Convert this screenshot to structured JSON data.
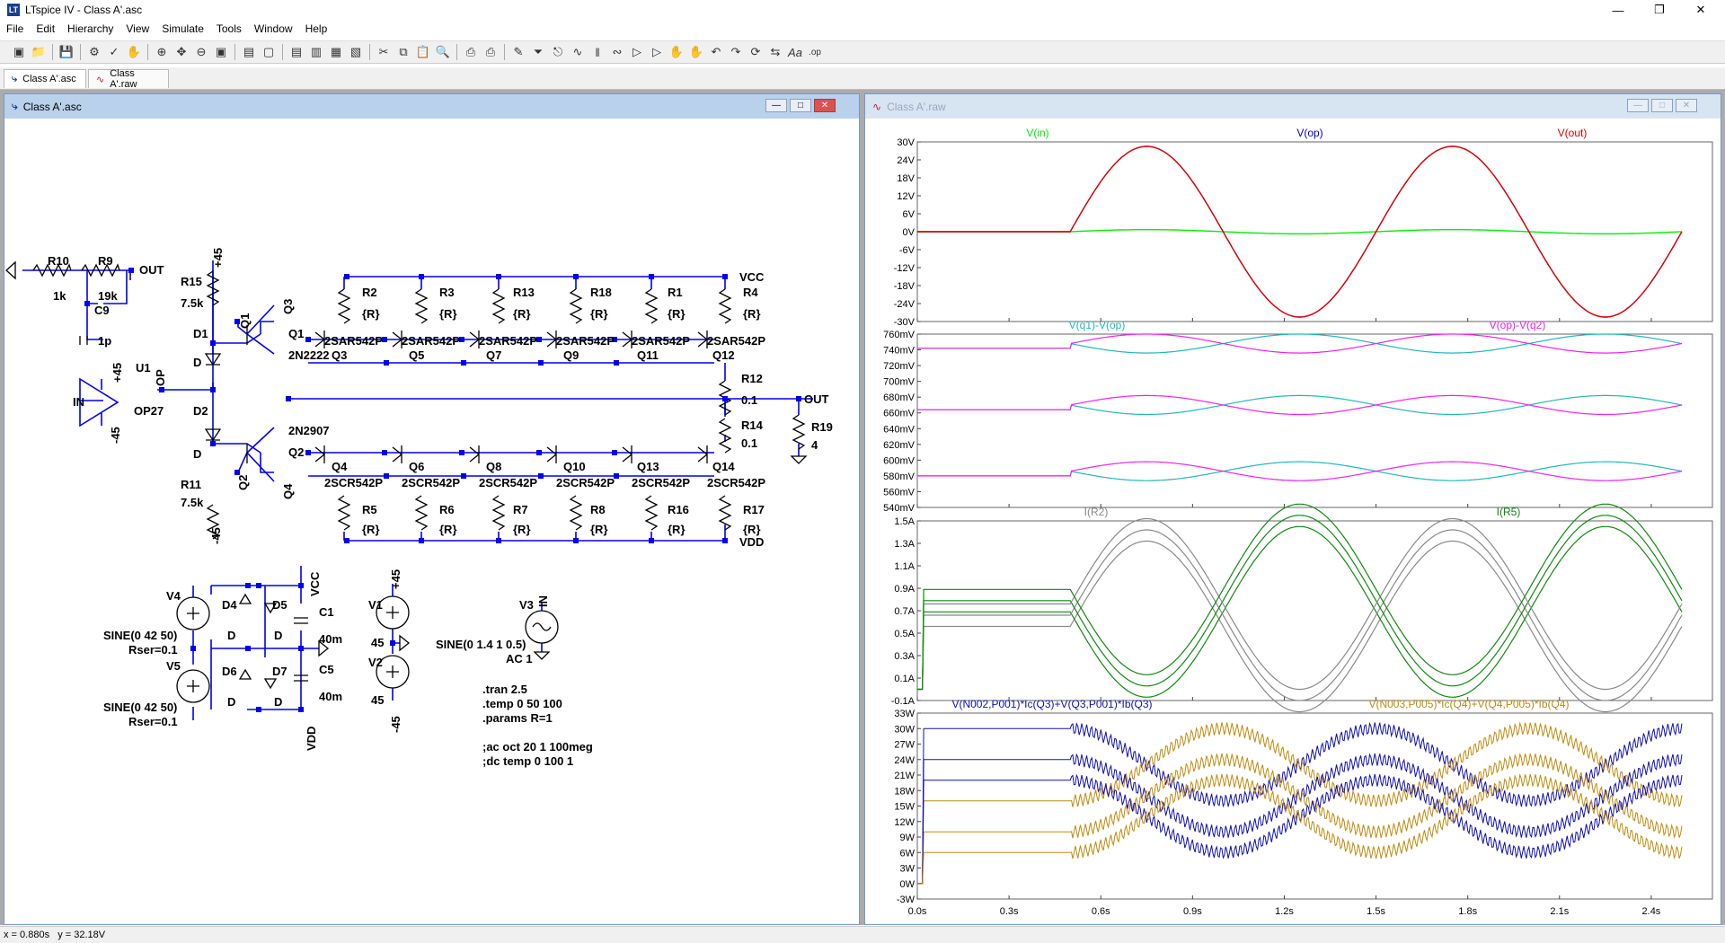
{
  "app": {
    "title": "LTspice IV - Class A'.asc",
    "icon": "ltspice-logo-icon"
  },
  "menu": [
    "File",
    "Edit",
    "Hierarchy",
    "View",
    "Simulate",
    "Tools",
    "Window",
    "Help"
  ],
  "tabs": [
    {
      "label": "Class A'.asc",
      "icon": "schematic-icon"
    },
    {
      "label": "Class A'.raw",
      "icon": "waveform-icon"
    }
  ],
  "schematic_window": {
    "title": "Class A'.asc"
  },
  "waveform_window": {
    "title": "Class A'.raw"
  },
  "schematic": {
    "labels": {
      "r10": "R10",
      "r9": "R9",
      "out_left": "OUT",
      "k1": "1k",
      "k19": "19k",
      "c9": "C9",
      "p1": "1p",
      "r15": "R15",
      "p45_top": "+45",
      "k75a": "7.5k",
      "q1v": "Q1",
      "q3v": "Q3",
      "d1": "D1",
      "d1v": "D",
      "q1": "Q1",
      "n2222": "2N2222",
      "u1": "U1",
      "p45_u1": "+45",
      "op": "OP",
      "in": "IN",
      "m45_u1": "-45",
      "op27": "OP27",
      "d2": "D2",
      "d2v": "D",
      "n2907": "2N2907",
      "q2": "Q2",
      "r11": "R11",
      "k75b": "7.5k",
      "m45_bot": "-45",
      "q2v": "Q2",
      "q4v": "Q4",
      "vcc": "VCC",
      "vdd": "VDD",
      "out_right": "OUT",
      "r12": "R12",
      "v01a": "0.1",
      "r14": "R14",
      "v01b": "0.1",
      "r19": "R19",
      "four": "4",
      "top_res": [
        "R2",
        "R3",
        "R13",
        "R18",
        "R1",
        "R4"
      ],
      "r_val": "{R}",
      "top_npn": [
        "Q3",
        "Q5",
        "Q7",
        "Q9",
        "Q11",
        "Q12"
      ],
      "top_part": "2SAR542P",
      "bot_pnp": [
        "Q4",
        "Q6",
        "Q8",
        "Q10",
        "Q13",
        "Q14"
      ],
      "bot_part": "2SCR542P",
      "bot_res": [
        "R5",
        "R6",
        "R7",
        "R8",
        "R16",
        "R17"
      ],
      "v4": "V4",
      "d4": "D4",
      "d5": "D5",
      "vcc2": "VCC",
      "c1": "C1",
      "m40a": "40m",
      "c5": "C5",
      "m40b": "40m",
      "vdd2": "VDD",
      "d4v": "D",
      "d5v": "D",
      "d6": "D6",
      "d7": "D7",
      "d6v": "D",
      "d7v": "D",
      "v5": "V5",
      "sine1": "SINE(0 42 50)",
      "rser1": "Rser=0.1",
      "sine2": "SINE(0 42 50)",
      "rser2": "Rser=0.1",
      "v1": "V1",
      "v1p": "+45",
      "v1v": "45",
      "v2": "V2",
      "v2v": "45",
      "v2m": "-45",
      "v3": "V3",
      "v3in": "IN",
      "sine3": "SINE(0 1.4 1 0.5)",
      "ac": "AC 1",
      "tran": ".tran 2.5",
      "temp": ".temp 0 50 100",
      "params": ".params R=1",
      "acoct": ";ac oct 20 1 100meg",
      "dctemp": ";dc temp 0 100 1"
    }
  },
  "waveform": {
    "pane1": {
      "traces": [
        "V(in)",
        "V(op)",
        "V(out)"
      ],
      "colors": [
        "#00ee00",
        "#0000cc",
        "#dd0000"
      ],
      "yticks": [
        "30V",
        "24V",
        "18V",
        "12V",
        "6V",
        "0V",
        "-6V",
        "-12V",
        "-18V",
        "-24V",
        "-30V"
      ]
    },
    "pane2": {
      "traces": [
        "V(q1)-V(op)",
        "V(op)-V(q2)"
      ],
      "colors": [
        "#20b8b8",
        "#ee22ee"
      ],
      "yticks": [
        "760mV",
        "740mV",
        "720mV",
        "700mV",
        "680mV",
        "660mV",
        "640mV",
        "620mV",
        "600mV",
        "580mV",
        "560mV",
        "540mV"
      ]
    },
    "pane3": {
      "traces": [
        "I(R2)",
        "I(R5)"
      ],
      "colors": [
        "#888888",
        "#118811"
      ],
      "yticks": [
        "1.5A",
        "1.3A",
        "1.1A",
        "0.9A",
        "0.7A",
        "0.5A",
        "0.3A",
        "0.1A",
        "-0.1A"
      ]
    },
    "pane4": {
      "traces": [
        "V(N002,P001)*Ic(Q3)+V(Q3,P001)*Ib(Q3)",
        "V(N003,P005)*Ic(Q4)+V(Q4,P005)*Ib(Q4)"
      ],
      "colors": [
        "#1010b0",
        "#c08a10"
      ],
      "yticks": [
        "33W",
        "30W",
        "27W",
        "24W",
        "21W",
        "18W",
        "15W",
        "12W",
        "9W",
        "6W",
        "3W",
        "0W",
        "-3W"
      ]
    },
    "xticks": [
      "0.0s",
      "0.3s",
      "0.6s",
      "0.9s",
      "1.2s",
      "1.5s",
      "1.8s",
      "2.1s",
      "2.4s"
    ]
  },
  "status": {
    "text": "x = 0.880s   y = 32.18V"
  }
}
